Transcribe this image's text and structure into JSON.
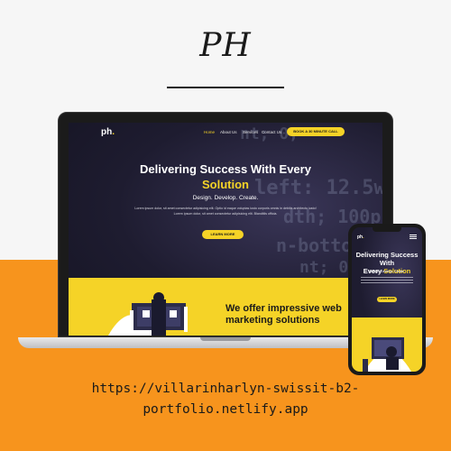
{
  "brand": {
    "monogram": "PH"
  },
  "site": {
    "logo_main": "ph",
    "logo_dot": ".",
    "nav": [
      "Home",
      "About Us",
      "Services",
      "Contact Us"
    ],
    "cta_label": "BOOK A 30 MINUTE CALL",
    "hero": {
      "title_line1": "Delivering Success With Every",
      "title_accent": "Solution",
      "tagline": "Design. Develop. Create.",
      "body_line1": "Lorem ipsum dolor, sit amet consectetur adipisicing elit. Optio id eaque voluptas iusto corporis omnis in debitis architecto iusto!",
      "body_line2": "Lorem ipsum dolor, sit amet consectetur adipisicing elit. Blanditiis officia.",
      "learn_more": "LEARN MORE"
    },
    "section2": {
      "title_line1": "We offer impressive web",
      "title_line2": "marketing solutions"
    }
  },
  "mobile": {
    "title_line1": "Delivering Success With",
    "title_line2": "Every",
    "title_accent": "Solution",
    "tagline": "Design. Develop. Create.",
    "learn_more": "LEARN MORE"
  },
  "url_line1": "https://villarinharlyn-swissit-b2-",
  "url_line2": "portfolio.netlify.app",
  "colors": {
    "accent": "#f5d327",
    "band": "#f7941d",
    "dark": "#1e1c30"
  }
}
